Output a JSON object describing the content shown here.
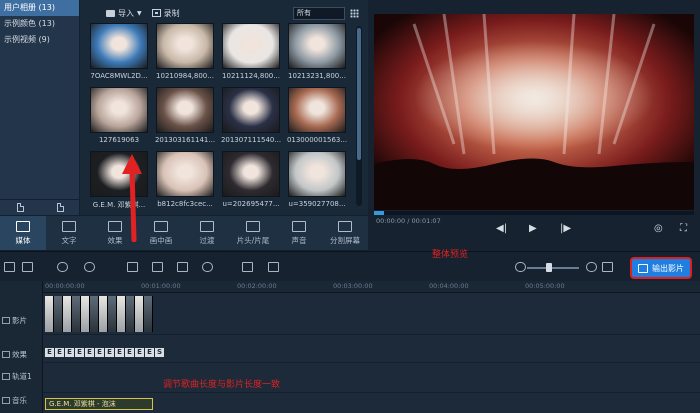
{
  "sidebar": {
    "items": [
      {
        "label": "用户相册 (13)",
        "active": true
      },
      {
        "label": "示例颜色 (13)",
        "active": false
      },
      {
        "label": "示例视频 (9)",
        "active": false
      }
    ]
  },
  "library": {
    "import_label": "导入",
    "record_label": "录制",
    "filter_value": "所有",
    "thumbnails": [
      {
        "caption": "7OAC8MWL2D...",
        "tone": "#3d7ab8"
      },
      {
        "caption": "10210984,800...",
        "tone": "#c9b8a8"
      },
      {
        "caption": "10211124,800...",
        "tone": "#e9e6e4"
      },
      {
        "caption": "10213231,800...",
        "tone": "#8e9aa4"
      },
      {
        "caption": "127619063",
        "tone": "#b8a49a"
      },
      {
        "caption": "201303161141...",
        "tone": "#6a5248"
      },
      {
        "caption": "201307111540...",
        "tone": "#2a3046"
      },
      {
        "caption": "013000001563...",
        "tone": "#a86a52"
      },
      {
        "caption": "G.E.M. 邓紫棋...",
        "tone": "#1c1f22"
      },
      {
        "caption": "b812c8fc3cec...",
        "tone": "#d9c2b6"
      },
      {
        "caption": "u=202695477...",
        "tone": "#2e2a30"
      },
      {
        "caption": "u=359027708...",
        "tone": "#c2c6c8"
      }
    ]
  },
  "tools": [
    {
      "label": "媒体",
      "active": true
    },
    {
      "label": "文字",
      "active": false
    },
    {
      "label": "效果",
      "active": false
    },
    {
      "label": "画中画",
      "active": false
    },
    {
      "label": "过渡",
      "active": false
    },
    {
      "label": "片头/片尾",
      "active": false
    },
    {
      "label": "声音",
      "active": false
    },
    {
      "label": "分割屏幕",
      "active": false
    }
  ],
  "preview": {
    "time": "00:00:00 / 00:01:07",
    "progress": 0.03
  },
  "timeline": {
    "export_label": "输出影片",
    "ruler": [
      "00:00:00:00",
      "00:01:00:00",
      "00:02:00:00",
      "00:03:00:00",
      "00:04:00:00",
      "00:05:00:00"
    ],
    "tracks": [
      "影片",
      "效果",
      "轨道1",
      "音乐"
    ],
    "fx_marks": [
      "E",
      "E",
      "E",
      "E",
      "E",
      "E",
      "E",
      "E",
      "E",
      "E",
      "E",
      "S"
    ],
    "music_clip": "G.E.M. 邓紫棋 - 泡沫"
  },
  "annotations": {
    "preview_note": "整体预览",
    "timeline_note": "调节歌曲长度与影片长度一致"
  },
  "colors": {
    "accent": "#3e6fa0",
    "export": "#1f7fe0",
    "annotation": "#e02222"
  }
}
